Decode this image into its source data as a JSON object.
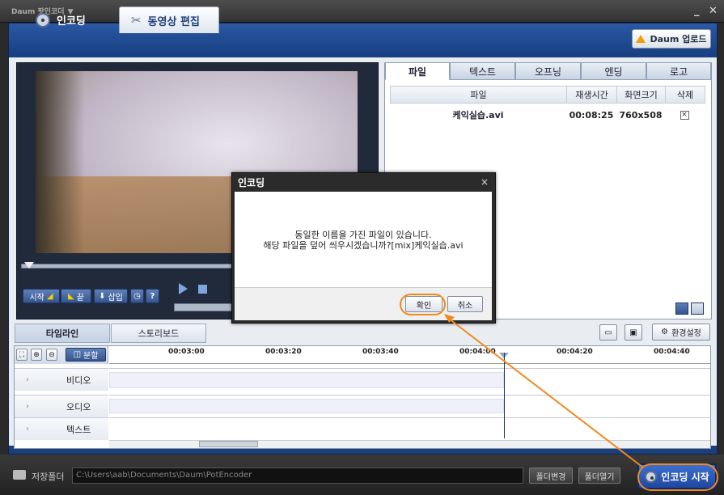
{
  "app": {
    "title": "Daum 팟인코더"
  },
  "nav": {
    "tab_encoding": "인코딩",
    "tab_edit": "동영상 편집",
    "upload": "Daum 업로드"
  },
  "player": {
    "start": "시작",
    "end": "끝",
    "insert": "삽입",
    "help": "?"
  },
  "right": {
    "tabs": [
      "파일",
      "텍스트",
      "오프닝",
      "엔딩",
      "로고"
    ],
    "columns": [
      "파일",
      "재생시간",
      "화면크기",
      "삭제"
    ],
    "file": {
      "name": "케익실습.avi",
      "duration": "00:08:25",
      "size": "760x508",
      "delete": "×"
    }
  },
  "timeline": {
    "tabs": [
      "타임라인",
      "스토리보드"
    ],
    "split": "분할",
    "settings": "환경설정",
    "ticks": [
      "00:03:00",
      "00:03:20",
      "00:03:40",
      "00:04:00",
      "00:04:20",
      "00:04:40"
    ],
    "tracks": [
      "비디오",
      "오디오",
      "텍스트"
    ]
  },
  "bottom": {
    "save_label": "저장폴더",
    "save_path": "C:\\Users\\aab\\Documents\\Daum\\PotEncoder",
    "change_folder": "폴더변경",
    "open_folder": "폴더열기",
    "start_encoding": "인코딩 시작"
  },
  "dialog": {
    "title": "인코딩",
    "close": "×",
    "line1": "동일한 이름을 가진 파일이 있습니다.",
    "line2": "해당 파일을 덮어 씌우시겠습니까?[mix]케익실습.avi",
    "ok": "확인",
    "cancel": "취소"
  },
  "colors": {
    "accent": "#1b3f7a",
    "highlight": "#f08a1a"
  }
}
